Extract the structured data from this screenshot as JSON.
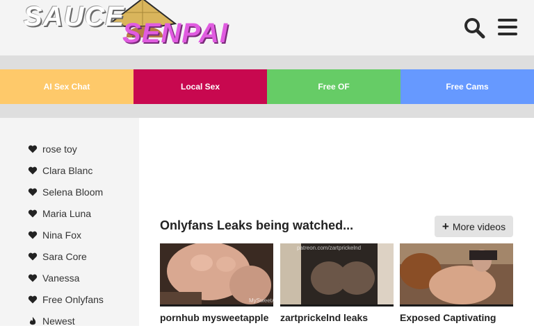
{
  "header": {
    "logo_part1": "SAUCE",
    "logo_part2": "SENPAI",
    "search_icon": "search-icon",
    "menu_icon": "hamburger-menu-icon"
  },
  "promo": [
    {
      "label": "AI Sex Chat",
      "color": "#fec96a"
    },
    {
      "label": "Local Sex",
      "color": "#c8084f"
    },
    {
      "label": "Free OF",
      "color": "#66cc66"
    },
    {
      "label": "Free Cams",
      "color": "#6699ff"
    }
  ],
  "sidebar": {
    "items": [
      {
        "label": "rose toy",
        "icon": "heart-icon"
      },
      {
        "label": "Clara Blanc",
        "icon": "heart-icon"
      },
      {
        "label": "Selena Bloom",
        "icon": "heart-icon"
      },
      {
        "label": "Maria Luna",
        "icon": "heart-icon"
      },
      {
        "label": "Nina Fox",
        "icon": "heart-icon"
      },
      {
        "label": "Sara Core",
        "icon": "heart-icon"
      },
      {
        "label": "Vanessa",
        "icon": "heart-icon"
      },
      {
        "label": "Free Onlyfans",
        "icon": "heart-icon"
      },
      {
        "label": "Newest",
        "icon": "fire-icon"
      }
    ]
  },
  "main": {
    "section_title": "Onlyfans Leaks being watched...",
    "more_button": "More videos",
    "videos": [
      {
        "title": "pornhub mysweetapple",
        "watermark": "MySweetApple"
      },
      {
        "title": "zartprickelnd leaks",
        "watermark": "patreon.com/zartprickelnd"
      },
      {
        "title": "Exposed Captivating",
        "watermark": ""
      }
    ]
  }
}
